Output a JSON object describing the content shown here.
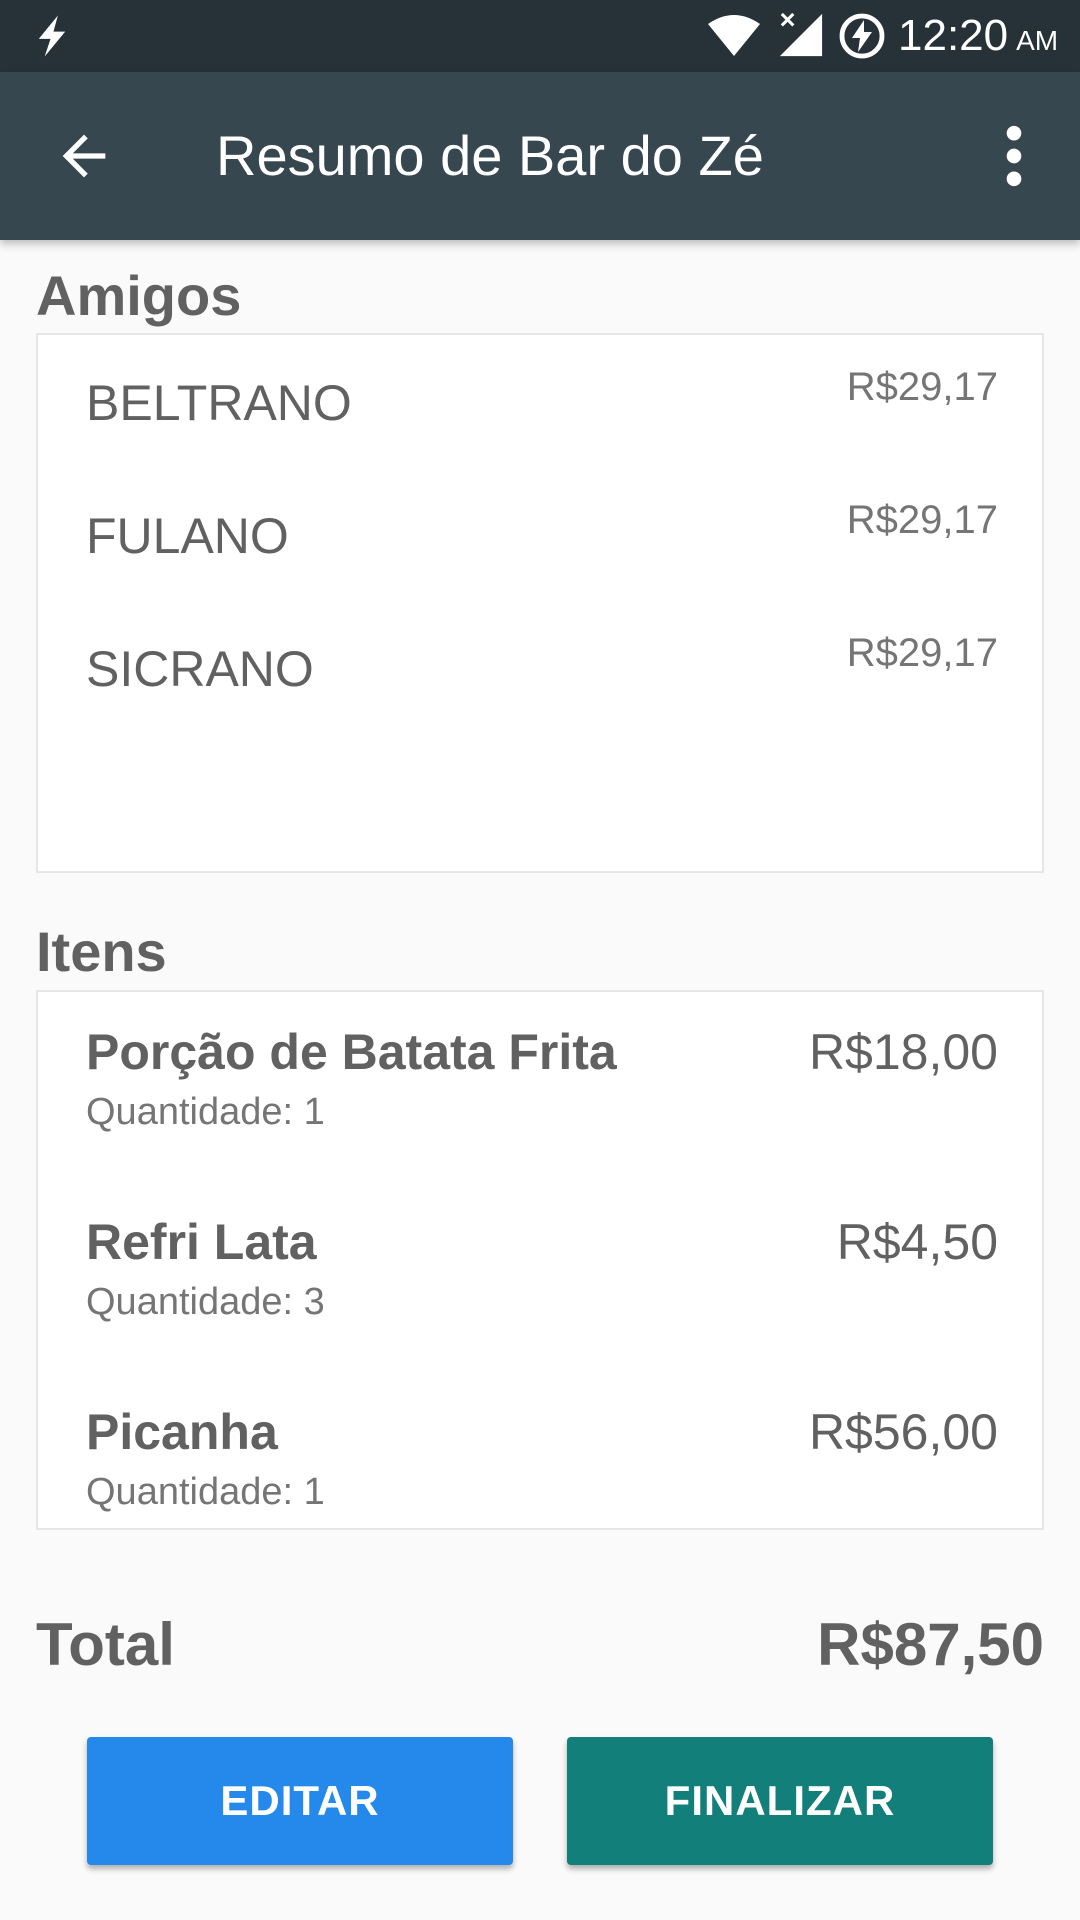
{
  "status_bar": {
    "time": "12:20",
    "ampm": "AM",
    "icons": [
      "flash-icon",
      "wifi-icon",
      "signal-icon",
      "battery-charging-icon"
    ]
  },
  "toolbar": {
    "title": "Resumo de Bar do Zé",
    "back_icon": "arrow-back-icon",
    "more_icon": "more-vert-icon"
  },
  "friends": {
    "title": "Amigos",
    "items": [
      {
        "name": "BELTRANO",
        "amount": "R$29,17"
      },
      {
        "name": "FULANO",
        "amount": "R$29,17"
      },
      {
        "name": "SICRANO",
        "amount": "R$29,17"
      }
    ]
  },
  "items": {
    "title": "Itens",
    "list": [
      {
        "name": "Porção de Batata Frita",
        "quantity": "Quantidade: 1",
        "price": "R$18,00"
      },
      {
        "name": "Refri Lata",
        "quantity": "Quantidade: 3",
        "price": "R$4,50"
      },
      {
        "name": "Picanha",
        "quantity": "Quantidade: 1",
        "price": "R$56,00"
      }
    ]
  },
  "total": {
    "label": "Total",
    "value": "R$87,50"
  },
  "actions": {
    "edit_label": "EDITAR",
    "finish_label": "FINALIZAR"
  },
  "colors": {
    "status_bar": "#263238",
    "toolbar": "#37474f",
    "edit_button": "#2589eb",
    "finish_button": "#127f7a"
  }
}
